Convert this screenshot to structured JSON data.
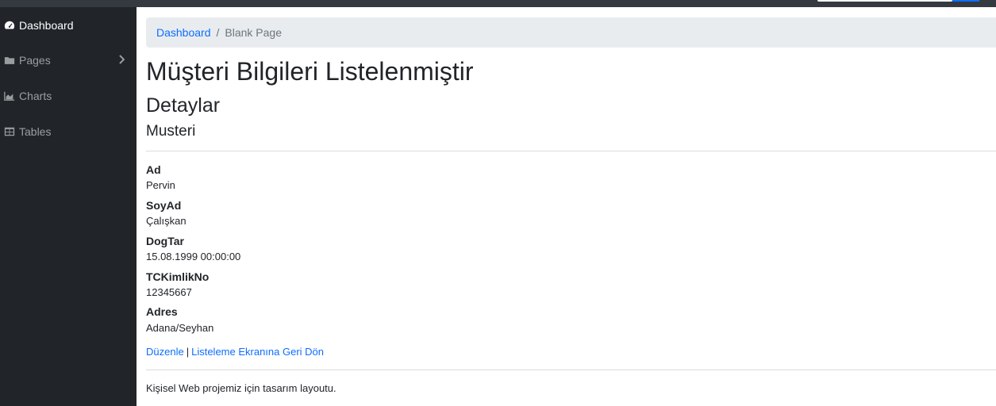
{
  "sidebar": {
    "items": [
      {
        "label": "Dashboard",
        "icon": "dashboard-icon",
        "active": true
      },
      {
        "label": "Pages",
        "icon": "folder-icon",
        "has_submenu": true
      },
      {
        "label": "Charts",
        "icon": "area-chart-icon"
      },
      {
        "label": "Tables",
        "icon": "table-icon"
      }
    ]
  },
  "breadcrumb": {
    "home": "Dashboard",
    "separator": "/",
    "current": "Blank Page"
  },
  "main": {
    "title": "Müşteri Bilgileri Listelenmiştir",
    "subtitle": "Detaylar",
    "section": "Musteri",
    "fields": [
      {
        "label": "Ad",
        "value": "Pervin"
      },
      {
        "label": "SoyAd",
        "value": "Çalışkan"
      },
      {
        "label": "DogTar",
        "value": "15.08.1999 00:00:00"
      },
      {
        "label": "TCKimlikNo",
        "value": "12345667"
      },
      {
        "label": "Adres",
        "value": "Adana/Seyhan"
      }
    ],
    "edit_link": "Düzenle",
    "link_separator": "|",
    "back_link": "Listeleme Ekranına Geri Dön"
  },
  "footer": {
    "text": "Kişisel Web projemiz için tasarım layoutu."
  },
  "colors": {
    "sidebar_bg": "#212529",
    "topbar_bg": "#343a40",
    "link": "#0d6efd",
    "breadcrumb_bg": "#e9ecef"
  }
}
